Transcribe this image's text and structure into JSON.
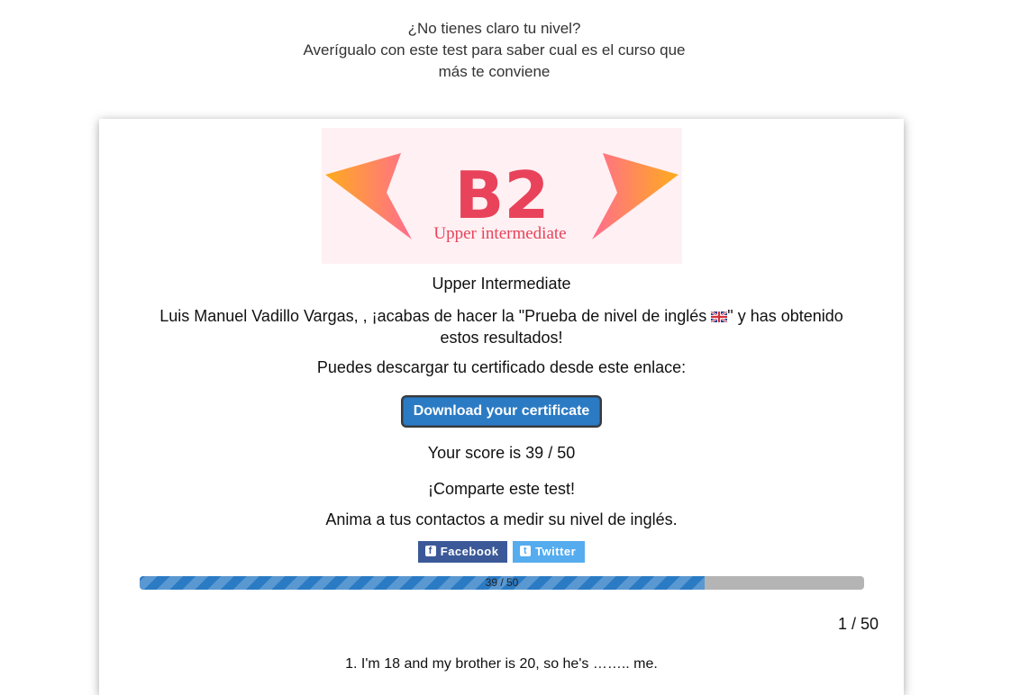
{
  "intro": {
    "line1": "¿No tienes claro tu nivel?",
    "line2": "Averígualo con este test para saber cual es el curso que",
    "line3": "más te conviene"
  },
  "badge": {
    "level_code": "B2",
    "level_label": "Upper intermediate",
    "accent_color": "#e8435a",
    "arrow_gradient": [
      "#ffab1e",
      "#ff6d8e"
    ]
  },
  "result": {
    "level_name": "Upper Intermediate",
    "message_part1": "Luis Manuel Vadillo Vargas, , ¡acabas de hacer la \"Prueba de nivel de inglés ",
    "message_part2": "\" y has obtenido estos resultados!",
    "flag_icon": "uk-flag-icon",
    "certificate_text": "Puedes descargar tu certificado desde este enlace:",
    "download_label": "Download your certificate",
    "score_text": "Your score is 39 / 50"
  },
  "share": {
    "title": "¡Comparte este test!",
    "subtitle": "Anima a tus contactos a medir su nivel de inglés.",
    "facebook_label": "Facebook",
    "twitter_label": "Twitter",
    "facebook_color": "#3b5998",
    "twitter_color": "#55acee"
  },
  "progress": {
    "label": "39 / 50",
    "fraction": 0.78
  },
  "pager": {
    "counter": "1 / 50"
  },
  "question": {
    "text": "1. I'm 18 and my brother is 20, so he's …….. me."
  }
}
